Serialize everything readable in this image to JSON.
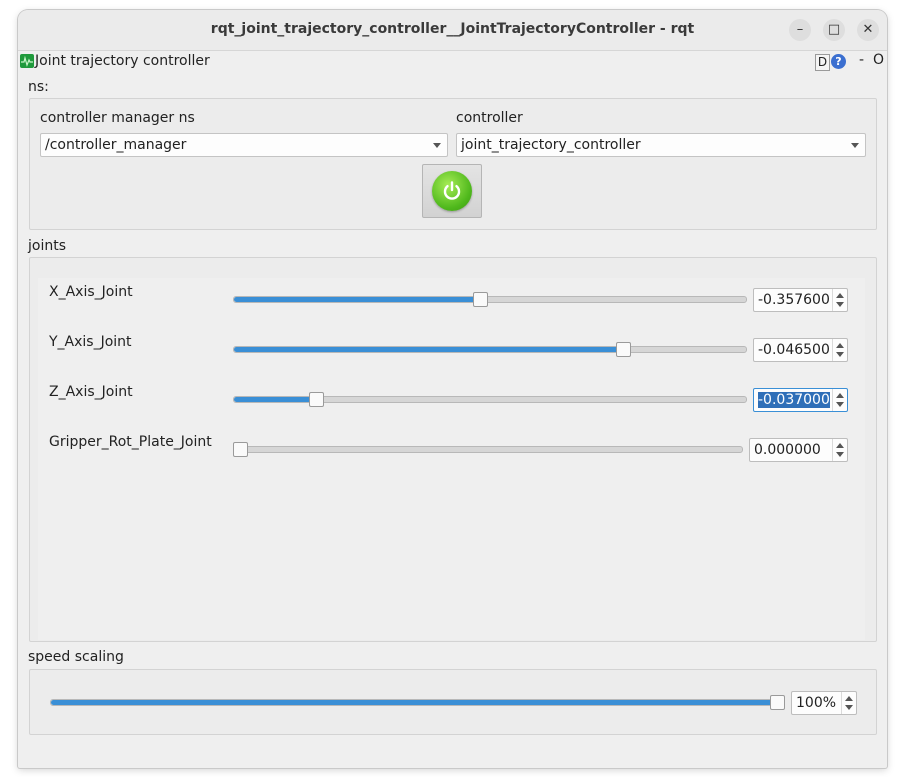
{
  "window": {
    "title": "rqt_joint_trajectory_controller__JointTrajectoryController - rqt",
    "minimize_icon": "minimize-icon",
    "maximize_icon": "maximize-icon",
    "close_icon": "close-icon",
    "minimize_glyph": "–",
    "maximize_glyph": "□",
    "close_glyph": "✕"
  },
  "dock": {
    "title": "Joint trajectory controller",
    "d_label": "D",
    "help_label": "?",
    "minimize_label": "-",
    "close_label": "O"
  },
  "ns": {
    "section_label": "ns:",
    "controller_manager_label": "controller manager ns",
    "controller_manager_value": "/controller_manager",
    "controller_label": "controller",
    "controller_value": "joint_trajectory_controller",
    "enable_button_icon": "power-icon",
    "accent_color": "#4fb81c"
  },
  "joints": {
    "section_label": "joints",
    "items": [
      {
        "name": "X_Axis_Joint",
        "value": "-0.357600",
        "slider_fraction": 0.48
      },
      {
        "name": "Y_Axis_Joint",
        "value": "-0.046500",
        "slider_fraction": 0.76
      },
      {
        "name": "Z_Axis_Joint",
        "value": "-0.037000",
        "slider_fraction": 0.16,
        "selected": true
      },
      {
        "name": "Gripper_Rot_Plate_Joint",
        "value": "0.000000",
        "slider_fraction": 0.0
      }
    ],
    "slider_color": "#3a8fd6"
  },
  "speed": {
    "section_label": "speed scaling",
    "value": "100%",
    "slider_fraction": 1.0
  }
}
